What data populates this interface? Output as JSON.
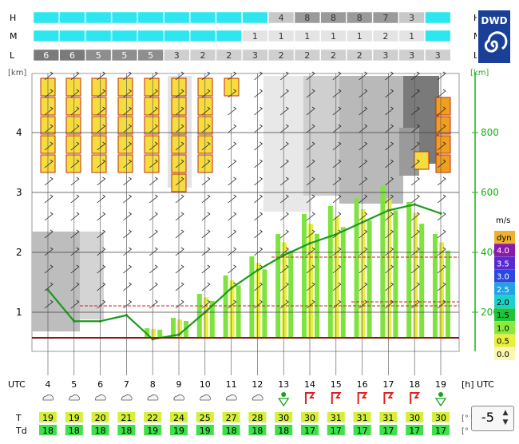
{
  "logo": {
    "text": "DWD"
  },
  "cloud_rows": {
    "labels": [
      "H",
      "M",
      "L"
    ],
    "H": [
      "",
      "",
      "",
      "",
      "",
      "",
      "",
      "",
      "",
      "4",
      "8",
      "8",
      "8",
      "7",
      "3",
      ""
    ],
    "M": [
      "",
      "",
      "",
      "",
      "",
      "",
      "",
      "",
      "1",
      "1",
      "1",
      "1",
      "1",
      "2",
      "1",
      ""
    ],
    "L": [
      "6",
      "6",
      "5",
      "5",
      "5",
      "3",
      "2",
      "2",
      "3",
      "2",
      "2",
      "2",
      "2",
      "3",
      "3",
      "3"
    ]
  },
  "axes": {
    "left_unit": "[km]",
    "right_unit": "[km]",
    "left_ticks": [
      "1",
      "2",
      "3",
      "4"
    ],
    "right_ticks": [
      "200",
      "400",
      "600",
      "800"
    ],
    "time_label_left": "UTC",
    "time_label_right": "[h] UTC",
    "hours": [
      "4",
      "5",
      "6",
      "7",
      "8",
      "9",
      "10",
      "11",
      "12",
      "13",
      "14",
      "15",
      "16",
      "17",
      "18",
      "19"
    ]
  },
  "legend": {
    "unit": "m/s",
    "items": [
      {
        "label": "dyn",
        "color": "#f0b030"
      },
      {
        "label": "4.0",
        "color": "#8a1aa8"
      },
      {
        "label": "3.5",
        "color": "#5a2ad0"
      },
      {
        "label": "3.0",
        "color": "#2e46e0"
      },
      {
        "label": "2.5",
        "color": "#22a2e6"
      },
      {
        "label": "2.0",
        "color": "#1ad2c8"
      },
      {
        "label": "1.5",
        "color": "#1ec33a"
      },
      {
        "label": "1.0",
        "color": "#8ce83c"
      },
      {
        "label": "0.5",
        "color": "#e8ef3e"
      },
      {
        "label": "0.0",
        "color": "#fbf6b0"
      }
    ]
  },
  "chart_data": {
    "type": "line",
    "x": [
      4,
      5,
      6,
      7,
      8,
      9,
      10,
      11,
      12,
      13,
      14,
      15,
      16,
      17,
      18,
      19
    ],
    "series": [
      {
        "values": [
          275,
          170,
          170,
          190,
          110,
          125,
          200,
          280,
          340,
          390,
          430,
          460,
          500,
          540,
          560,
          530
        ]
      }
    ],
    "ylim_right": [
      0,
      1000
    ],
    "ylim_left_km": [
      0,
      5
    ]
  },
  "weather": {
    "row_labels": {
      "T": "T",
      "Td": "Td"
    },
    "symbols": [
      "cloud",
      "cloud",
      "cloud",
      "cloud",
      "cloud",
      "cloud",
      "cloud",
      "cloud",
      "cloud",
      "shower",
      "thunder",
      "thunder",
      "thunder",
      "thunder",
      "thunder",
      "shower"
    ],
    "T": [
      "19",
      "19",
      "20",
      "21",
      "22",
      "24",
      "25",
      "27",
      "28",
      "30",
      "30",
      "31",
      "31",
      "31",
      "30",
      "30"
    ],
    "Td": [
      "18",
      "18",
      "18",
      "18",
      "19",
      "19",
      "19",
      "18",
      "18",
      "18",
      "17",
      "17",
      "17",
      "17",
      "17",
      "17"
    ],
    "T_color": "#d6ef3c",
    "Td_color": "#3fe04a",
    "T_unit": "[°",
    "Td_unit": "[°"
  },
  "spinner": {
    "value": "-5"
  }
}
